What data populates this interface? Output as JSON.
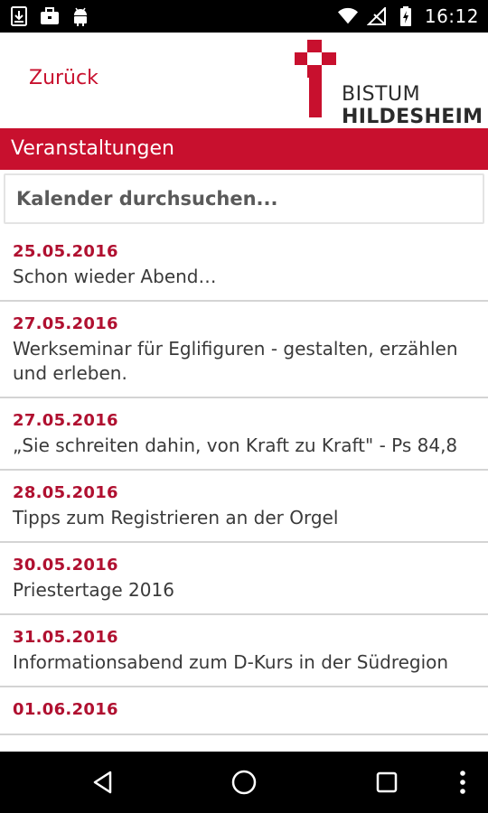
{
  "status_bar": {
    "time": "16:12",
    "left_icons": [
      "download-icon",
      "briefcase-icon",
      "android-icon"
    ],
    "right_icons": [
      "wifi-icon",
      "no-signal-icon",
      "battery-charging-icon"
    ]
  },
  "header": {
    "back_label": "Zurück",
    "logo_line1": "BISTUM",
    "logo_line2": "HILDESHEIM"
  },
  "section": {
    "title": "Veranstaltungen"
  },
  "search": {
    "placeholder": "Kalender durchsuchen..."
  },
  "events": [
    {
      "date": "25.05.2016",
      "title": "Schon wieder Abend…"
    },
    {
      "date": "27.05.2016",
      "title": "Werkseminar für Eglifiguren - gestalten, erzählen und erleben."
    },
    {
      "date": "27.05.2016",
      "title": "„Sie schreiten dahin, von Kraft zu Kraft\" - Ps 84,8"
    },
    {
      "date": "28.05.2016",
      "title": "Tipps zum Registrieren an der Orgel"
    },
    {
      "date": "30.05.2016",
      "title": "Priestertage 2016"
    },
    {
      "date": "31.05.2016",
      "title": "Informationsabend zum D-Kurs in der Südregion"
    },
    {
      "date": "01.06.2016",
      "title": ""
    }
  ],
  "colors": {
    "accent": "#c8102e",
    "date": "#b01030",
    "text": "#3a3a3a"
  },
  "nav_icons": [
    "back-triangle-icon",
    "home-circle-icon",
    "recents-square-icon",
    "overflow-menu-icon"
  ]
}
